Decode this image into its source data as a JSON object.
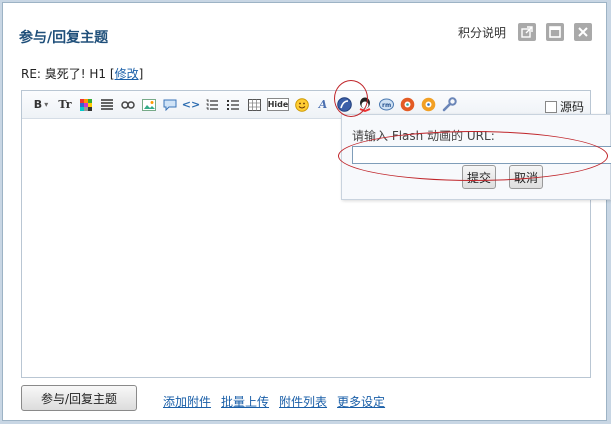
{
  "dialog": {
    "title": "参与/回复主题",
    "points_link": "积分说明"
  },
  "subject": {
    "prefix": "RE: 臭死了! H1 [",
    "edit": "修改",
    "suffix": "]"
  },
  "toolbar": {
    "hide_label": "Hide",
    "source_label": "源码"
  },
  "flash_popup": {
    "label": "请输入 Flash 动画的 URL:",
    "input_value": "",
    "submit": "提交",
    "cancel": "取消"
  },
  "footer": {
    "submit_button": "参与/回复主题",
    "links": [
      "添加附件",
      "批量上传",
      "附件列表",
      "更多设定"
    ]
  },
  "colors": {
    "accent_title": "#1f4f7a",
    "link": "#1a5fa8",
    "annotation": "#c0262b"
  }
}
